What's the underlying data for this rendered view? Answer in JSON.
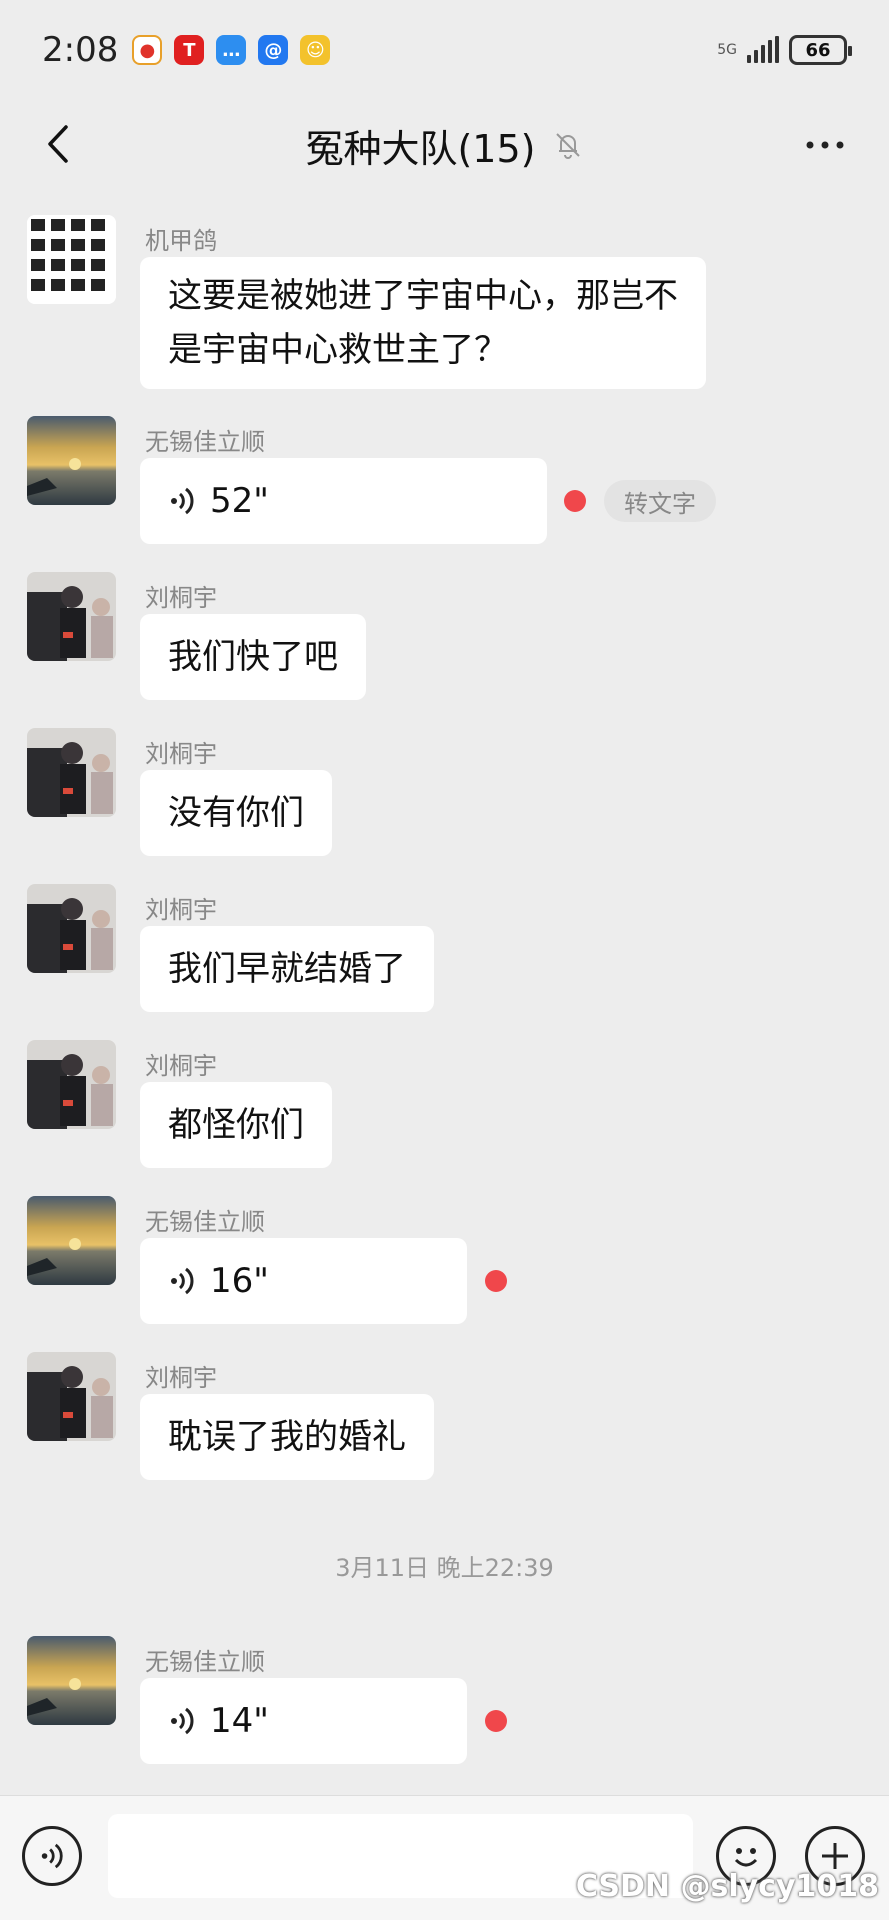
{
  "status_bar": {
    "time": "2:08",
    "battery": "66",
    "network_label": "5G"
  },
  "nav": {
    "title": "冤种大队(15)"
  },
  "messages": [
    {
      "sender": "机甲鸽",
      "text": "这要是被她进了宇宙中心，那岂不",
      "text2": "是宇宙中心救世主了？"
    },
    {
      "sender": "无锡佳立顺",
      "voice": "52\"",
      "to_text": "转文字"
    },
    {
      "sender": "刘桐宇",
      "text": "我们快了吧"
    },
    {
      "sender": "刘桐宇",
      "text": "没有你们"
    },
    {
      "sender": "刘桐宇",
      "text": "我们早就结婚了"
    },
    {
      "sender": "刘桐宇",
      "text": "都怪你们"
    },
    {
      "sender": "无锡佳立顺",
      "voice": "16\""
    },
    {
      "sender": "刘桐宇",
      "text": "耽误了我的婚礼"
    },
    {
      "sender": "无锡佳立顺",
      "voice": "14\""
    }
  ],
  "timestamp": "3月11日 晚上22:39",
  "watermark": "CSDN @slycy1018",
  "colors": {
    "background": "#ededed",
    "bubble": "#ffffff",
    "unread_dot": "#f0474b"
  }
}
